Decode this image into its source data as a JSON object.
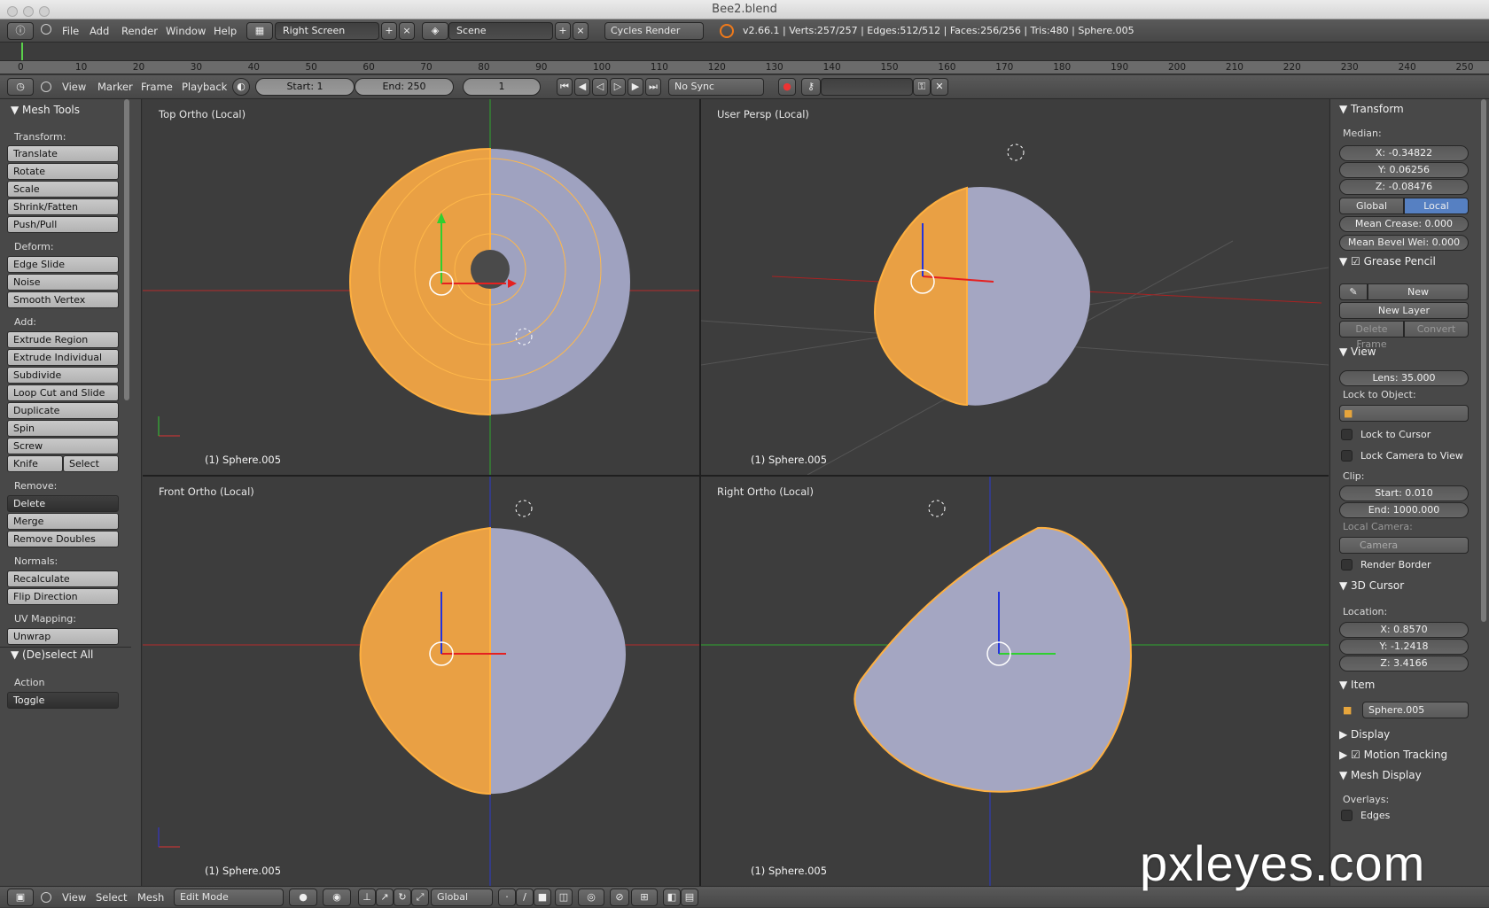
{
  "window": {
    "title": "Bee2.blend"
  },
  "info_header": {
    "menus": [
      "File",
      "Add",
      "Render",
      "Window",
      "Help"
    ],
    "screen": "Right Screen",
    "scene": "Scene",
    "engine": "Cycles Render",
    "stats": "v2.66.1 | Verts:257/257 | Edges:512/512 | Faces:256/256 | Tris:480 | Sphere.005"
  },
  "timeline": {
    "ticks": [
      "0",
      "10",
      "20",
      "30",
      "40",
      "50",
      "60",
      "70",
      "80",
      "90",
      "100",
      "110",
      "120",
      "130",
      "140",
      "150",
      "160",
      "170",
      "180",
      "190",
      "200",
      "210",
      "220",
      "230",
      "240",
      "250"
    ]
  },
  "timeline_header": {
    "menus": [
      "View",
      "Marker",
      "Frame",
      "Playback"
    ],
    "start": "Start: 1",
    "end": "End: 250",
    "current": "1",
    "sync": "No Sync"
  },
  "toolshelf": {
    "title": "Mesh Tools",
    "transform_label": "Transform:",
    "transform": [
      "Translate",
      "Rotate",
      "Scale",
      "Shrink/Fatten",
      "Push/Pull"
    ],
    "deform_label": "Deform:",
    "deform": [
      "Edge Slide",
      "Noise",
      "Smooth Vertex"
    ],
    "add_label": "Add:",
    "add": [
      "Extrude Region",
      "Extrude Individual",
      "Subdivide",
      "Loop Cut and Slide",
      "Duplicate",
      "Spin",
      "Screw"
    ],
    "knife": "Knife",
    "select": "Select",
    "remove_label": "Remove:",
    "delete": "Delete",
    "remove": [
      "Merge",
      "Remove Doubles"
    ],
    "normals_label": "Normals:",
    "normals": [
      "Recalculate",
      "Flip Direction"
    ],
    "uv_label": "UV Mapping:",
    "unwrap": "Unwrap",
    "deselect_title": "(De)select All",
    "action_label": "Action",
    "toggle": "Toggle"
  },
  "views": {
    "top": "Top Ortho (Local)",
    "persp": "User Persp (Local)",
    "front": "Front Ortho (Local)",
    "right": "Right Ortho (Local)",
    "object": "(1) Sphere.005",
    "axes": {
      "x": "x",
      "y": "y",
      "z": "z"
    }
  },
  "properties": {
    "transform_title": "Transform",
    "median_label": "Median:",
    "x": "X: -0.34822",
    "y": "Y: 0.06256",
    "z": "Z: -0.08476",
    "global": "Global",
    "local": "Local",
    "crease": "Mean Crease: 0.000",
    "bevel": "Mean Bevel Wei: 0.000",
    "gp_title": "Grease Pencil",
    "gp_new": "New",
    "gp_new_layer": "New Layer",
    "gp_delete_frame": "Delete Frame",
    "gp_convert": "Convert",
    "view_title": "View",
    "lens": "Lens: 35.000",
    "lock_obj_label": "Lock to Object:",
    "lock_cursor": "Lock to Cursor",
    "lock_camera": "Lock Camera to View",
    "clip_label": "Clip:",
    "clip_start": "Start: 0.010",
    "clip_end": "End: 1000.000",
    "local_camera_label": "Local Camera:",
    "camera": "Camera",
    "render_border": "Render Border",
    "cursor_title": "3D Cursor",
    "location_label": "Location:",
    "cx": "X: 0.8570",
    "cy": "Y: -1.2418",
    "cz": "Z: 3.4166",
    "item_title": "Item",
    "item_name": "Sphere.005",
    "display_title": "Display",
    "motion_title": "Motion Tracking",
    "mesh_display_title": "Mesh Display",
    "overlays_label": "Overlays:",
    "edges_label": "Edges"
  },
  "bottom_header": {
    "menus": [
      "View",
      "Select",
      "Mesh"
    ],
    "mode": "Edit Mode",
    "orientation": "Global"
  },
  "watermark": "pxleyes.com",
  "colors": {
    "selected": "#f5a23a",
    "mesh": "#a4a6c2",
    "viewport": "#3d3d3d",
    "x_axis": "#c42a2a",
    "y_axis": "#3aa83a",
    "z_axis": "#2a3ad0"
  }
}
